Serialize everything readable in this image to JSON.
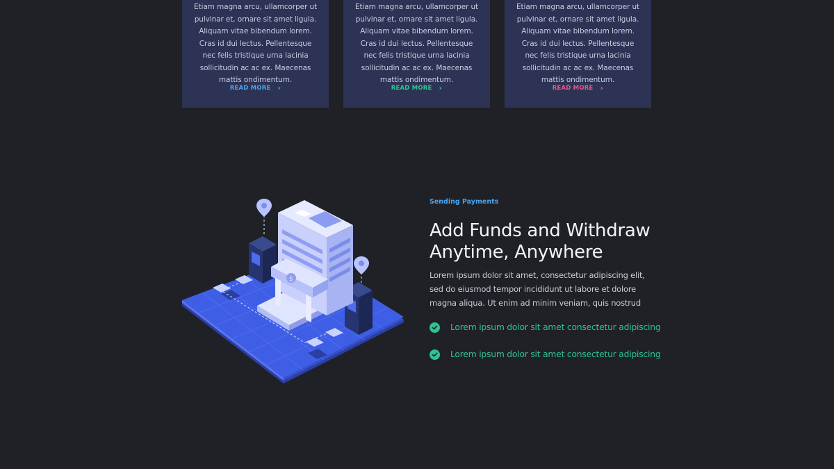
{
  "cards": [
    {
      "body": "Etiam magna arcu, ullamcorper ut pulvinar et, ornare sit amet ligula. Aliquam vitae bibendum lorem. Cras id dui lectus. Pellentesque nec felis tristique urna lacinia sollicitudin ac ac ex. Maecenas mattis ondimentum.",
      "link": "READ MORE",
      "color": "#4aa3ef"
    },
    {
      "body": "Etiam magna arcu, ullamcorper ut pulvinar et, ornare sit amet ligula. Aliquam vitae bibendum lorem. Cras id dui lectus. Pellentesque nec felis tristique urna lacinia sollicitudin ac ac ex. Maecenas mattis ondimentum.",
      "link": "READ MORE",
      "color": "#2ec491"
    },
    {
      "body": "Etiam magna arcu, ullamcorper ut pulvinar et, ornare sit amet ligula. Aliquam vitae bibendum lorem. Cras id dui lectus. Pellentesque nec felis tristique urna lacinia sollicitudin ac ac ex. Maecenas mattis ondimentum.",
      "link": "READ MORE",
      "color": "#e8578a"
    }
  ],
  "feature": {
    "eyebrow": "Sending Payments",
    "title_line1": "Add Funds and Withdraw",
    "title_line2": "Anytime, Anywhere",
    "description": "Lorem ipsum dolor sit amet, consectetur adipiscing elit, sed do eiusmod tempor incididunt ut labore et dolore magna aliqua. Ut enim ad minim veniam, quis nostrud",
    "checklist": [
      "Lorem ipsum dolor sit amet consectetur adipiscing",
      "Lorem ipsum dolor sit amet consectetur adipiscing"
    ],
    "illustration_icon": "bank-atm-isometric-icon"
  },
  "colors": {
    "background": "#1f2127",
    "card": "#2c3354",
    "accent_blue": "#4aa3ef",
    "accent_green": "#2ec491",
    "accent_pink": "#e8578a"
  }
}
